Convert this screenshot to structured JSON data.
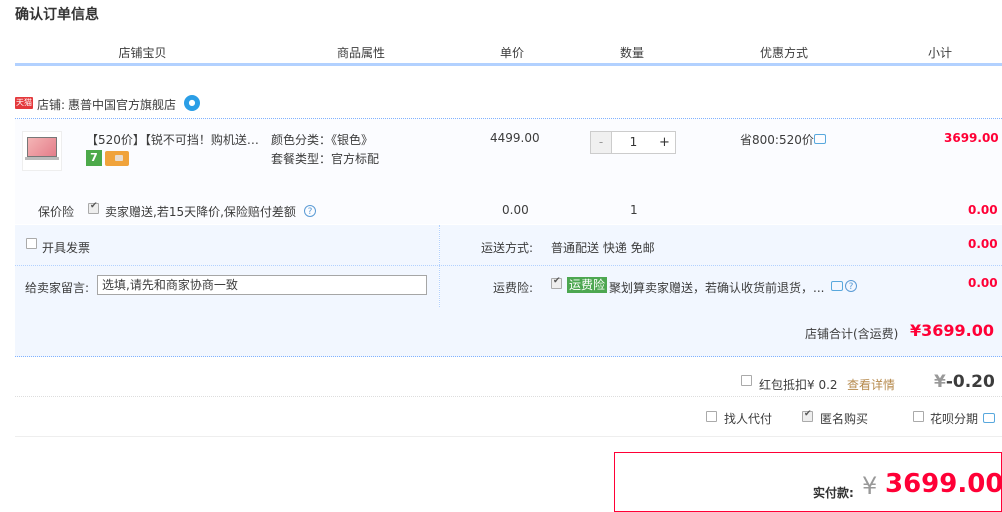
{
  "page_title": "确认订单信息",
  "columns": [
    "店铺宝贝",
    "商品属性",
    "单价",
    "数量",
    "优惠方式",
    "小计"
  ],
  "store": {
    "badge": "天猫",
    "label": "店铺:",
    "name": "惠普中国官方旗舰店"
  },
  "item": {
    "title": "【520价】【锐不可挡！购机送…",
    "attr_color": "颜色分类：《银色》",
    "attr_package": "套餐类型：官方标配",
    "unit_price": "4499.00",
    "qty_minus": "-",
    "quantity": "1",
    "qty_plus": "+",
    "discount": "省800:520价",
    "subtotal": "3699.00",
    "service_badge": "7"
  },
  "insurance": {
    "label": "保价险",
    "desc": "卖家赠送,若15天降价,保险赔付差额",
    "price": "0.00",
    "qty": "1",
    "subtotal": "0.00"
  },
  "invoice": {
    "label": "开具发票"
  },
  "memo": {
    "label": "给卖家留言:",
    "placeholder": "选填,请先和商家协商一致"
  },
  "shipping": {
    "label": "运送方式:",
    "value": "普通配送 快递 免邮",
    "fee": "0.00"
  },
  "freight_insurance": {
    "label": "运费险:",
    "tag": "运费险",
    "desc": "聚划算卖家赠送，若确认收货前退货，...",
    "fee": "0.00"
  },
  "store_total": {
    "label": "店铺合计(含运费)",
    "value": "¥3699.00"
  },
  "red_packet": {
    "label": "红包抵扣¥ 0.2",
    "link": "查看详情",
    "yen": "¥",
    "value": "-0.20"
  },
  "order_options": {
    "pay_for_me": "找人代付",
    "anonymous": "匿名购买",
    "huabei": "花呗分期"
  },
  "payment": {
    "label": "实付款:",
    "yen": "¥",
    "value": "3699.00"
  },
  "colors": {
    "accent_red": "#ff0036",
    "header_blue": "#b2d1ff",
    "panel_bg": "#f2f7ff"
  }
}
